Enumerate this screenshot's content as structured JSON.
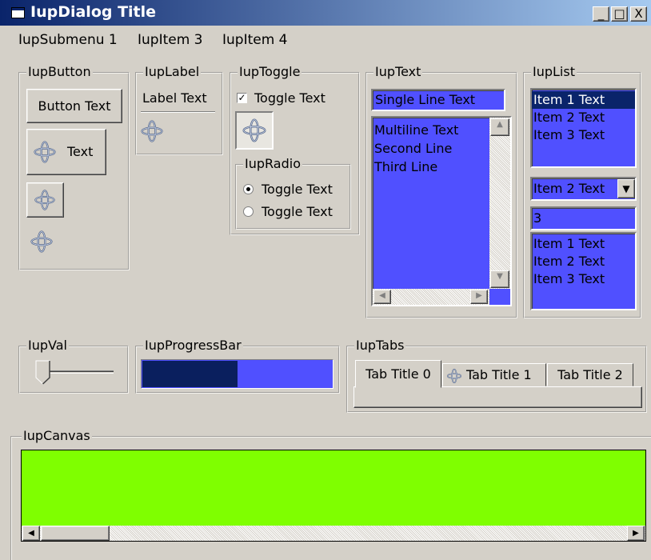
{
  "window": {
    "title": "IupDialog Title",
    "buttons": {
      "minimize": "_",
      "maximize": "□",
      "close": "X"
    }
  },
  "menu": {
    "items": [
      "IupSubmenu 1",
      "IupItem 3",
      "IupItem 4"
    ]
  },
  "groups": {
    "button": {
      "title": "IupButton",
      "text_button": "Button Text",
      "icon_text_button": "Text",
      "icons": "orbit-icon"
    },
    "label": {
      "title": "IupLabel",
      "text": "Label Text"
    },
    "toggle": {
      "title": "IupToggle",
      "check_label": "Toggle Text",
      "checked": true
    },
    "radio": {
      "title": "IupRadio",
      "options": [
        {
          "label": "Toggle Text",
          "selected": true
        },
        {
          "label": "Toggle Text",
          "selected": false
        }
      ]
    },
    "text": {
      "title": "IupText",
      "single_line": "Single Line Text",
      "multiline": [
        "Multiline Text",
        "Second Line",
        "Third Line"
      ]
    },
    "list": {
      "title": "IupList",
      "list1": [
        "Item 1 Text",
        "Item 2 Text",
        "Item 3 Text"
      ],
      "list1_selected_index": 0,
      "dropdown_value": "Item 2 Text",
      "edit_value": "3",
      "list2": [
        "Item 1 Text",
        "Item 2 Text",
        "Item 3 Text"
      ]
    },
    "val": {
      "title": "IupVal",
      "value_fraction": 0.0
    },
    "progress": {
      "title": "IupProgressBar",
      "value_fraction": 0.5
    },
    "tabs": {
      "title": "IupTabs",
      "tabs": [
        "Tab Title 0",
        "Tab Title 1",
        "Tab Title 2"
      ],
      "active_index": 0
    },
    "canvas": {
      "title": "IupCanvas",
      "background_color": "#7fff00"
    }
  },
  "colors": {
    "title_gradient_start": "#0a246a",
    "title_gradient_end": "#a6caf0",
    "control_blue": "#5050ff",
    "selection_dark": "#0a246a",
    "face": "#d4d0c8"
  }
}
